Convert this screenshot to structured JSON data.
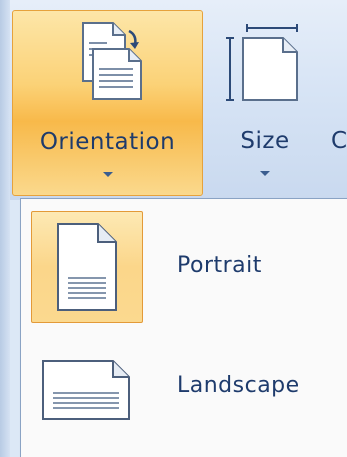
{
  "ribbon": {
    "orientation": {
      "label": "Orientation",
      "icon": "orientation-icon",
      "state": "open"
    },
    "size": {
      "label": "Size",
      "icon": "size-icon"
    },
    "next_partial_label": "C"
  },
  "menu": {
    "items": [
      {
        "label": "Portrait",
        "icon": "portrait-page-icon",
        "selected": true
      },
      {
        "label": "Landscape",
        "icon": "landscape-page-icon",
        "selected": false
      }
    ]
  },
  "colors": {
    "highlight_border": "#e39a38",
    "highlight_fill": "#fbd68a",
    "label_text": "#1e3b6c",
    "ribbon_bg": "#d7e4f5"
  }
}
